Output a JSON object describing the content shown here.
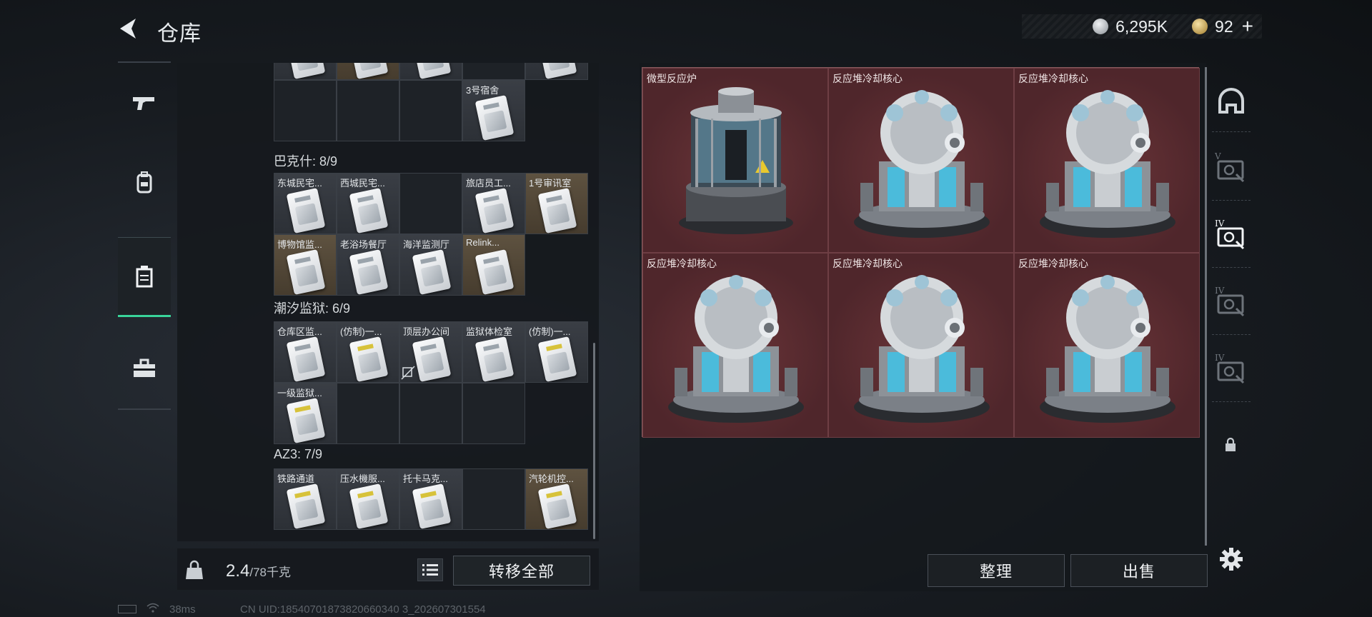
{
  "header": {
    "title": "仓库"
  },
  "currency": {
    "silver": "6,295K",
    "gold": "92",
    "plus": "+"
  },
  "left_nav": [
    "gun-icon",
    "backpack-icon",
    "keycard-case-icon",
    "toolbox-icon"
  ],
  "inventory": {
    "groups": [
      {
        "label": "",
        "rows": [
          [
            {
              "t": "",
              "s": "item"
            },
            {
              "t": "",
              "s": "gold"
            },
            {
              "t": "",
              "s": "item"
            },
            {
              "t": "",
              "s": "empty"
            },
            {
              "t": "",
              "s": "item"
            }
          ],
          [
            {
              "t": "",
              "s": "empty"
            },
            {
              "t": "",
              "s": "empty"
            },
            {
              "t": "",
              "s": "empty"
            },
            {
              "t": "3号宿舍",
              "s": "item"
            },
            {
              "t": "",
              "s": "none"
            }
          ]
        ]
      },
      {
        "label": "巴克什: 8/9",
        "rows": [
          [
            {
              "t": "东城民宅...",
              "s": "item"
            },
            {
              "t": "西城民宅...",
              "s": "item"
            },
            {
              "t": "",
              "s": "empty"
            },
            {
              "t": "旅店员工...",
              "s": "item"
            },
            {
              "t": "1号审讯室",
              "s": "gold"
            }
          ],
          [
            {
              "t": "博物馆监...",
              "s": "gold"
            },
            {
              "t": "老浴场餐厅",
              "s": "item"
            },
            {
              "t": "海洋监测厅",
              "s": "item"
            },
            {
              "t": "Relink...",
              "s": "gold"
            },
            {
              "t": "",
              "s": "none"
            }
          ]
        ]
      },
      {
        "label": "潮汐监狱: 6/9",
        "rows": [
          [
            {
              "t": "仓库区监...",
              "s": "item"
            },
            {
              "t": "(仿制)一...",
              "s": "item",
              "y": true
            },
            {
              "t": "顶层办公间",
              "s": "item"
            },
            {
              "t": "监狱体检室",
              "s": "item"
            },
            {
              "t": "(仿制)一...",
              "s": "item",
              "y": true
            }
          ],
          [
            {
              "t": "一级监狱...",
              "s": "item",
              "y": true
            },
            {
              "t": "",
              "s": "empty"
            },
            {
              "t": "",
              "s": "empty"
            },
            {
              "t": "",
              "s": "empty"
            },
            {
              "t": "",
              "s": "none"
            }
          ]
        ]
      },
      {
        "label": "AZ3: 7/9",
        "rows": [
          [
            {
              "t": "铁路通道",
              "s": "item",
              "y": true
            },
            {
              "t": "压水機服...",
              "s": "item",
              "y": true
            },
            {
              "t": "托卡马克...",
              "s": "item",
              "y": true
            },
            {
              "t": "",
              "s": "empty"
            },
            {
              "t": "汽轮机控...",
              "s": "gold",
              "y": true
            }
          ]
        ]
      }
    ]
  },
  "weight": {
    "current": "2.4",
    "max": "/78千克"
  },
  "buttons": {
    "transfer_all": "转移全部",
    "sort": "整理",
    "sell": "出售"
  },
  "container": {
    "items": [
      {
        "name": "微型反应炉",
        "type": "reactor"
      },
      {
        "name": "反应堆冷却核心",
        "type": "core"
      },
      {
        "name": "反应堆冷却核心",
        "type": "core"
      },
      {
        "name": "反应堆冷却核心",
        "type": "core"
      },
      {
        "name": "反应堆冷却核心",
        "type": "core"
      },
      {
        "name": "反应堆冷却核心",
        "type": "core"
      }
    ]
  },
  "right_tabs": [
    {
      "icon": "helmet-icon",
      "level": ""
    },
    {
      "icon": "keycard-tier-icon",
      "level": "V"
    },
    {
      "icon": "keycard-tier-icon",
      "level": "IV"
    },
    {
      "icon": "keycard-tier-icon",
      "level": "IV"
    },
    {
      "icon": "keycard-tier-icon",
      "level": "IV"
    }
  ],
  "status": {
    "ping": "38ms",
    "uid": "CN UID:18540701873820660340 3_202607301554"
  },
  "colors": {
    "accent": "#39d49a",
    "slot_red": "#5a2a2f",
    "gold_slot": "#5e5240"
  }
}
